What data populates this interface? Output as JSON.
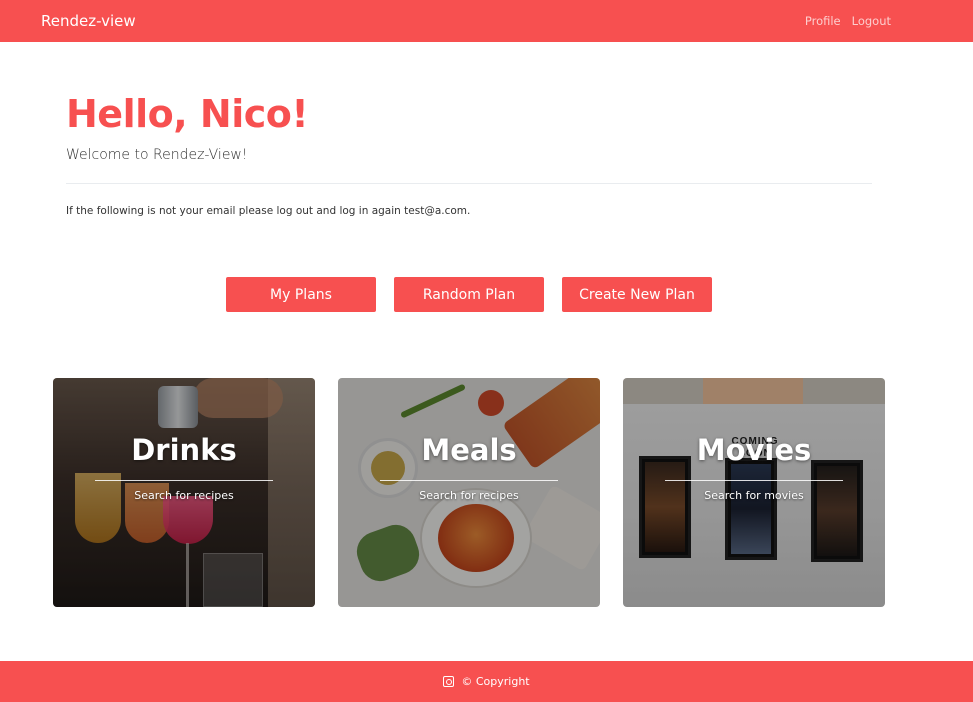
{
  "navbar": {
    "brand": "Rendez-view",
    "links": [
      {
        "label": "Profile"
      },
      {
        "label": "Logout"
      }
    ]
  },
  "hero": {
    "greeting": "Hello, Nico!",
    "lead": "Welcome to Rendez-View!",
    "note": "If the following is not your email please log out and log in again test@a.com."
  },
  "actions": [
    {
      "label": "My Plans"
    },
    {
      "label": "Random Plan"
    },
    {
      "label": "Create New Plan"
    }
  ],
  "cards": [
    {
      "title": "Drinks",
      "subtitle": "Search for recipes"
    },
    {
      "title": "Meals",
      "subtitle": "Search for recipes"
    },
    {
      "title": "Movies",
      "subtitle": "Search for movies",
      "sign_text": "COMING SOON"
    }
  ],
  "footer": {
    "icon": "copyright-logo-icon",
    "text": "© Copyright"
  },
  "colors": {
    "accent": "#f75050",
    "text": "#212529"
  }
}
